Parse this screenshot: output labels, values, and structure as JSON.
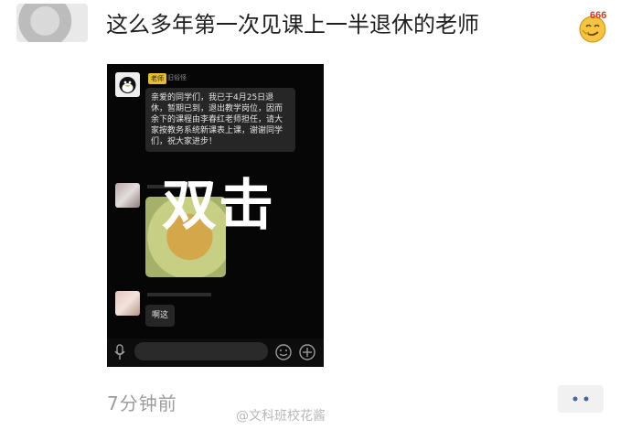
{
  "post": {
    "text": "这么多年第一次见课上一半退休的老师",
    "emoji_badge": "666",
    "time": "7分钟前"
  },
  "screenshot": {
    "teacher_tag": "老师",
    "teacher_name": "旧俗怪",
    "announcement": "亲爱的同学们，我已于4月25日退休，暂期已到，退出教学岗位，因而余下的课程由李春红老师担任，请大家按教务系统新课表上课，谢谢同学们，祝大家进步！",
    "overlay_text": "双击",
    "reply": "啊这"
  },
  "watermark": "@文科班校花酱",
  "icons": {
    "voice": "voice-icon",
    "emoji": "emoji-icon",
    "plus": "plus-icon",
    "more": "more-icon"
  },
  "colors": {
    "chat_bg": "#060606",
    "bubble": "#262626",
    "tag": "#e3bd38"
  }
}
